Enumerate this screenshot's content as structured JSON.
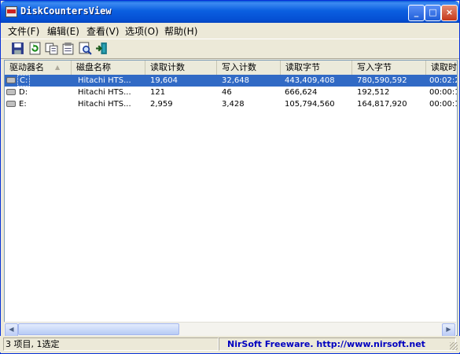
{
  "window": {
    "title": "DiskCountersView"
  },
  "titlebar_buttons": {
    "minimize": "_",
    "maximize": "□",
    "close": "×"
  },
  "menubar": [
    "文件(F)",
    "编辑(E)",
    "查看(V)",
    "选项(O)",
    "帮助(H)"
  ],
  "toolbar": [
    "save-icon",
    "refresh-icon",
    "copy-icon",
    "properties-icon",
    "find-icon",
    "exit-icon"
  ],
  "columns": [
    "驱动器名",
    "磁盘名称",
    "读取计数",
    "写入计数",
    "读取字节",
    "写入字节",
    "读取时"
  ],
  "rows": [
    {
      "drive": "C:",
      "disk": "Hitachi HTS...",
      "read_count": "19,604",
      "write_count": "32,648",
      "read_bytes": "443,409,408",
      "write_bytes": "780,590,592",
      "read_time": "00:02:2",
      "selected": true
    },
    {
      "drive": "D:",
      "disk": "Hitachi HTS...",
      "read_count": "121",
      "write_count": "46",
      "read_bytes": "666,624",
      "write_bytes": "192,512",
      "read_time": "00:00:1",
      "selected": false
    },
    {
      "drive": "E:",
      "disk": "Hitachi HTS...",
      "read_count": "2,959",
      "write_count": "3,428",
      "read_bytes": "105,794,560",
      "write_bytes": "164,817,920",
      "read_time": "00:00:1",
      "selected": false
    }
  ],
  "status": {
    "items": "3 项目, 1选定",
    "credit": "NirSoft Freeware.  http://www.nirsoft.net"
  },
  "colors": {
    "selection": "#316ac5",
    "credit": "#0000c0"
  }
}
